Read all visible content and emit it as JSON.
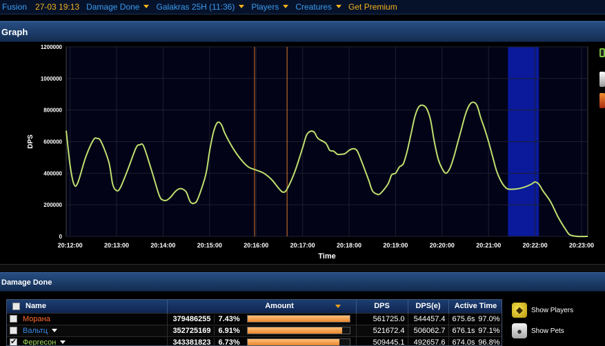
{
  "topbar": {
    "app": "Fusion",
    "date": "27-03 19:13",
    "view": "Damage Done",
    "encounter": "Galakras 25H (11:36)",
    "players": "Players",
    "creatures": "Creatures",
    "premium": "Get Premium"
  },
  "graph": {
    "header": "Graph"
  },
  "damage_done": {
    "header": "Damage Done"
  },
  "colors": {
    "line": "#c0e070",
    "highlight": "#0a1a9a",
    "marker": "#e07828",
    "nav_link": "#3b9cf0",
    "nav_gold": "#f3b21c"
  },
  "chart_data": {
    "type": "line",
    "ylabel": "DPS",
    "xlabel": "Time",
    "ylim": [
      0,
      1200000
    ],
    "yticks": [
      0,
      200000,
      400000,
      600000,
      800000,
      1000000,
      1200000
    ],
    "ytick_labels": [
      "0",
      "200000",
      "400000",
      "600000",
      "800000",
      "1000000",
      "1200000"
    ],
    "xlim": [
      "20:11:55",
      "20:23:08"
    ],
    "xticks": [
      "20:12:00",
      "20:13:00",
      "20:14:00",
      "20:15:00",
      "20:16:00",
      "20:17:00",
      "20:18:00",
      "20:19:00",
      "20:20:00",
      "20:21:00",
      "20:22:00",
      "20:23:00"
    ],
    "grid": true,
    "markers": [
      "20:15:58",
      "20:16:40"
    ],
    "highlight": [
      "20:21:25",
      "20:22:05"
    ],
    "series": [
      {
        "values": [
          [
            "20:11:55",
            670000
          ],
          [
            "20:12:00",
            450000
          ],
          [
            "20:12:05",
            330000
          ],
          [
            "20:12:10",
            340000
          ],
          [
            "20:12:20",
            500000
          ],
          [
            "20:12:30",
            610000
          ],
          [
            "20:12:35",
            620000
          ],
          [
            "20:12:40",
            600000
          ],
          [
            "20:12:50",
            470000
          ],
          [
            "20:12:55",
            330000
          ],
          [
            "20:13:00",
            290000
          ],
          [
            "20:13:05",
            310000
          ],
          [
            "20:13:15",
            430000
          ],
          [
            "20:13:25",
            560000
          ],
          [
            "20:13:30",
            580000
          ],
          [
            "20:13:35",
            570000
          ],
          [
            "20:13:45",
            420000
          ],
          [
            "20:13:55",
            260000
          ],
          [
            "20:14:00",
            230000
          ],
          [
            "20:14:05",
            230000
          ],
          [
            "20:14:10",
            250000
          ],
          [
            "20:14:15",
            280000
          ],
          [
            "20:14:20",
            300000
          ],
          [
            "20:14:25",
            300000
          ],
          [
            "20:14:30",
            280000
          ],
          [
            "20:14:35",
            220000
          ],
          [
            "20:14:40",
            210000
          ],
          [
            "20:14:45",
            240000
          ],
          [
            "20:14:55",
            390000
          ],
          [
            "20:15:00",
            540000
          ],
          [
            "20:15:05",
            660000
          ],
          [
            "20:15:10",
            720000
          ],
          [
            "20:15:15",
            710000
          ],
          [
            "20:15:20",
            650000
          ],
          [
            "20:15:30",
            560000
          ],
          [
            "20:15:40",
            490000
          ],
          [
            "20:15:50",
            440000
          ],
          [
            "20:16:00",
            420000
          ],
          [
            "20:16:10",
            400000
          ],
          [
            "20:16:20",
            360000
          ],
          [
            "20:16:30",
            300000
          ],
          [
            "20:16:35",
            280000
          ],
          [
            "20:16:40",
            300000
          ],
          [
            "20:16:50",
            410000
          ],
          [
            "20:17:00",
            560000
          ],
          [
            "20:17:05",
            640000
          ],
          [
            "20:17:10",
            665000
          ],
          [
            "20:17:15",
            660000
          ],
          [
            "20:17:20",
            620000
          ],
          [
            "20:17:30",
            590000
          ],
          [
            "20:17:35",
            545000
          ],
          [
            "20:17:40",
            540000
          ],
          [
            "20:17:45",
            520000
          ],
          [
            "20:17:50",
            520000
          ],
          [
            "20:17:55",
            525000
          ],
          [
            "20:18:00",
            545000
          ],
          [
            "20:18:05",
            555000
          ],
          [
            "20:18:10",
            545000
          ],
          [
            "20:18:15",
            490000
          ],
          [
            "20:18:25",
            360000
          ],
          [
            "20:18:30",
            290000
          ],
          [
            "20:18:35",
            270000
          ],
          [
            "20:18:40",
            270000
          ],
          [
            "20:18:50",
            330000
          ],
          [
            "20:18:55",
            390000
          ],
          [
            "20:19:00",
            400000
          ],
          [
            "20:19:05",
            440000
          ],
          [
            "20:19:10",
            460000
          ],
          [
            "20:19:15",
            540000
          ],
          [
            "20:19:20",
            650000
          ],
          [
            "20:19:25",
            760000
          ],
          [
            "20:19:30",
            820000
          ],
          [
            "20:19:35",
            830000
          ],
          [
            "20:19:40",
            810000
          ],
          [
            "20:19:45",
            740000
          ],
          [
            "20:19:50",
            600000
          ],
          [
            "20:19:55",
            490000
          ],
          [
            "20:20:00",
            430000
          ],
          [
            "20:20:05",
            400000
          ],
          [
            "20:20:10",
            430000
          ],
          [
            "20:20:15",
            500000
          ],
          [
            "20:20:20",
            590000
          ],
          [
            "20:20:25",
            680000
          ],
          [
            "20:20:30",
            770000
          ],
          [
            "20:20:35",
            830000
          ],
          [
            "20:20:40",
            850000
          ],
          [
            "20:20:45",
            830000
          ],
          [
            "20:20:50",
            750000
          ],
          [
            "20:20:55",
            680000
          ],
          [
            "20:21:00",
            600000
          ],
          [
            "20:21:05",
            510000
          ],
          [
            "20:21:10",
            420000
          ],
          [
            "20:21:15",
            360000
          ],
          [
            "20:21:20",
            320000
          ],
          [
            "20:21:25",
            300000
          ],
          [
            "20:21:35",
            300000
          ],
          [
            "20:21:45",
            310000
          ],
          [
            "20:21:55",
            330000
          ],
          [
            "20:22:00",
            345000
          ],
          [
            "20:22:05",
            330000
          ],
          [
            "20:22:10",
            290000
          ],
          [
            "20:22:20",
            220000
          ],
          [
            "20:22:30",
            120000
          ],
          [
            "20:22:40",
            40000
          ],
          [
            "20:22:45",
            10000
          ],
          [
            "20:22:55",
            0
          ],
          [
            "20:23:08",
            0
          ]
        ]
      }
    ]
  },
  "table": {
    "columns": [
      "Name",
      "Amount",
      "DPS",
      "DPS(e)",
      "Active Time"
    ],
    "rows": [
      {
        "name": "Морана",
        "name_color": "#ff6a30",
        "checked": false,
        "dropdown": false,
        "amount": "379486255",
        "pct": "7.43%",
        "bar_fraction": 1.0,
        "dps": "561725.0",
        "dpse": "544457.4",
        "active": "675.6s",
        "active_pct": "97.0%"
      },
      {
        "name": "Вальтц",
        "name_color": "#3a8ae6",
        "checked": false,
        "dropdown": true,
        "amount": "352725169",
        "pct": "6.91%",
        "bar_fraction": 0.93,
        "dps": "521672.4",
        "dpse": "506062.7",
        "active": "676.1s",
        "active_pct": "97.1%"
      },
      {
        "name": "Фергесон",
        "name_color": "#9fe05a",
        "checked": true,
        "dropdown": true,
        "amount": "343381823",
        "pct": "6.73%",
        "bar_fraction": 0.905,
        "dps": "509445.1",
        "dpse": "492657.6",
        "active": "674.0s",
        "active_pct": "96.8%"
      }
    ]
  },
  "side_buttons": {
    "show_players": "Show Players",
    "show_pets": "Show Pets"
  }
}
